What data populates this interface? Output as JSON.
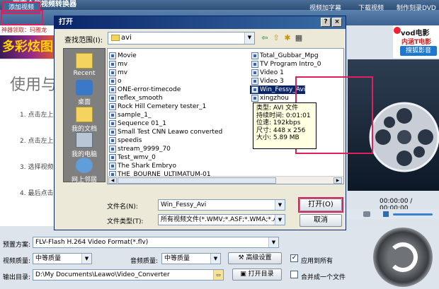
{
  "app": {
    "title": "狸窝全能视频转换器",
    "add_video": "添加视频",
    "top_links": [
      "视频加字幕",
      "下载视频",
      "制作刻录DVD"
    ],
    "promo_text": "神器领取：玛雅龙",
    "banner_text": "多彩炫图",
    "guide_title": "使用与",
    "guide_steps": [
      "1. 点击左上",
      "2. 点击左上",
      "3. 选择视频",
      "4. 最后点击"
    ],
    "vod": {
      "title": "vod电影",
      "subtitle": "内涵T电影",
      "button": "搜狐影音"
    },
    "preview_time": "00:00:00 / 00:00:00"
  },
  "bottom": {
    "preset_label": "预置方案:",
    "preset_value": "FLV-Flash H.264 Video Format(*.flv)",
    "video_quality_label": "视频质量:",
    "video_quality_value": "中等质量",
    "audio_quality_label": "音频质量:",
    "audio_quality_value": "中等质量",
    "advanced_settings": "高级设置",
    "apply_all_label": "应用到所有",
    "output_label": "输出目录:",
    "output_value": "D:\\My Documents\\Leawo\\Video_Converter",
    "open_dir": "打开目录",
    "merge_label": "合并成一个文件"
  },
  "dialog": {
    "title": "打开",
    "help": "?",
    "close": "×",
    "look_in_label": "查找范围(I):",
    "look_in_value": "avi",
    "places": [
      {
        "label": "Recent"
      },
      {
        "label": "桌面"
      },
      {
        "label": "我的文档"
      },
      {
        "label": "我的电脑"
      },
      {
        "label": "网上邻居"
      }
    ],
    "files_col1": [
      "Movie",
      "mv",
      "mv",
      "o",
      "ONE-error-timecode",
      "reflex_smooth",
      "Rock Hill Cemetery tester_1",
      "sample_1_",
      "Sequence 01_1",
      "Small Test CNN Leawo converted",
      "speedis",
      "stream_9999_70",
      "Test_wmv_0",
      "The Shark Embryo",
      "THE_BOURNE_ULTIMATUM-01"
    ],
    "files_col2": [
      "Total_Gubbar_Mpg",
      "TV Program Intro_0",
      "Video 1",
      "Video 3",
      "Win_Fessy_Avi",
      "xingzhou"
    ],
    "tooltip": [
      "类型: AVI 文件",
      "持续时间: 0:01:01",
      "位速: 192kbps",
      "尺寸: 448 x 256",
      "大小: 5.89 MB"
    ],
    "filename_label": "文件名(N):",
    "filename_value": "Win_Fessy_Avi",
    "filetype_label": "文件类型(T):",
    "filetype_value": "所有视频文件(*.WMV;*.ASF;*.WMA;*.AVI;",
    "open_button": "打开(O)",
    "cancel_button": "取消"
  },
  "colors": {
    "highlight": "#e0205a",
    "titlebar": "#0a246a",
    "selection": "#0a246a"
  }
}
